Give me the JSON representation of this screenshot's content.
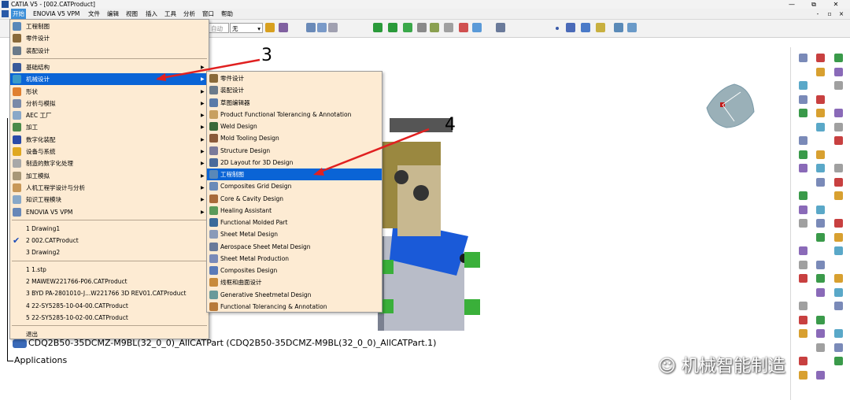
{
  "window": {
    "title": "CATIA V5 - [002.CATProduct]",
    "minimize": "—",
    "restore": "⧉",
    "close": "✕"
  },
  "menubar": {
    "items": [
      "开始",
      "ENOVIA V5 VPM",
      "文件",
      "编辑",
      "视图",
      "插入",
      "工具",
      "分析",
      "窗口",
      "帮助"
    ],
    "right": [
      "-",
      "▫",
      "×"
    ]
  },
  "toolbar": {
    "combo1": "自动",
    "combo2": "无"
  },
  "start_menu": {
    "items": [
      {
        "label": "工程制图",
        "icon": "drawing-icon",
        "color": "#5a88b8",
        "submenu": false
      },
      {
        "label": "零件设计",
        "icon": "part-design-icon",
        "color": "#8a6a3a",
        "submenu": false
      },
      {
        "label": "装配设计",
        "icon": "assembly-design-icon",
        "color": "#6a7a8a",
        "submenu": false
      },
      {
        "label": "基础结构",
        "icon": "infrastructure-icon",
        "color": "#3a5a9a",
        "submenu": true
      },
      {
        "label": "机械设计",
        "icon": "mechanical-design-icon",
        "color": "#3a9ac8",
        "submenu": true
      },
      {
        "label": "形状",
        "icon": "shape-icon",
        "color": "#e08030",
        "submenu": true
      },
      {
        "label": "分析与模拟",
        "icon": "analysis-icon",
        "color": "#7a8aa8",
        "submenu": true
      },
      {
        "label": "AEC 工厂",
        "icon": "aec-plant-icon",
        "color": "#8aa8c8",
        "submenu": true
      },
      {
        "label": "加工",
        "icon": "machining-icon",
        "color": "#4a8a4a",
        "submenu": true
      },
      {
        "label": "数字化装配",
        "icon": "digital-mockup-icon",
        "color": "#2a4aa8",
        "submenu": true
      },
      {
        "label": "设备与系统",
        "icon": "equipment-icon",
        "color": "#e0a820",
        "submenu": true
      },
      {
        "label": "制造的数字化处理",
        "icon": "manufacturing-icon",
        "color": "#a8a8a8",
        "submenu": true
      },
      {
        "label": "加工模拟",
        "icon": "machining-simulation-icon",
        "color": "#a89878",
        "submenu": true
      },
      {
        "label": "人机工程学设计与分析",
        "icon": "ergonomics-icon",
        "color": "#c89858",
        "submenu": true
      },
      {
        "label": "知识工程模块",
        "icon": "knowledgeware-icon",
        "color": "#88a8c8",
        "submenu": true
      },
      {
        "label": "ENOVIA V5 VPM",
        "icon": "enovia-icon",
        "color": "#6888b8",
        "submenu": true
      }
    ],
    "recent_windows": [
      "1 Drawing1",
      "2 002.CATProduct",
      "3 Drawing2"
    ],
    "recent_files": [
      "1 1.stp",
      "2 MAWEW221766-P06.CATProduct",
      "3 BYD PA-2801010-J...W221766 3D REV01.CATProduct",
      "4 22-SY5285-10-04-00.CATProduct",
      "5 22-SY5285-10-02-00.CATProduct"
    ],
    "exit": "退出"
  },
  "submenu": {
    "items": [
      {
        "label": "零件设计",
        "icon": "part-design-icon",
        "color": "#8a6a3a"
      },
      {
        "label": "装配设计",
        "icon": "assembly-design-icon",
        "color": "#6a7a8a"
      },
      {
        "label": "草图编辑器",
        "icon": "sketcher-icon",
        "color": "#5a7aa8"
      },
      {
        "label": "Product Functional Tolerancing & Annotation",
        "icon": "tolerancing-icon",
        "color": "#c8a060"
      },
      {
        "label": "Weld Design",
        "icon": "weld-design-icon",
        "color": "#3a6a3a"
      },
      {
        "label": "Mold Tooling Design",
        "icon": "mold-tooling-icon",
        "color": "#8a5a3a"
      },
      {
        "label": "Structure Design",
        "icon": "structure-design-icon",
        "color": "#7a7a9a"
      },
      {
        "label": "2D Layout for 3D Design",
        "icon": "layout-2d-icon",
        "color": "#4a6a9a"
      },
      {
        "label": "工程制图",
        "icon": "drawing-icon",
        "color": "#5a88b8"
      },
      {
        "label": "Composites Grid Design",
        "icon": "composites-grid-icon",
        "color": "#6a8ab8"
      },
      {
        "label": "Core & Cavity Design",
        "icon": "core-cavity-icon",
        "color": "#a86a3a"
      },
      {
        "label": "Healing Assistant",
        "icon": "healing-icon",
        "color": "#5a9a5a"
      },
      {
        "label": "Functional Molded Part",
        "icon": "molded-part-icon",
        "color": "#3a6a9a"
      },
      {
        "label": "Sheet Metal Design",
        "icon": "sheet-metal-icon",
        "color": "#8a9ab8"
      },
      {
        "label": "Aerospace Sheet Metal  Design",
        "icon": "aerospace-sheet-icon",
        "color": "#6a7a9a"
      },
      {
        "label": "Sheet Metal Production",
        "icon": "sheet-production-icon",
        "color": "#7a8ab8"
      },
      {
        "label": "Composites Design",
        "icon": "composites-icon",
        "color": "#5a7ab8"
      },
      {
        "label": "线框和曲面设计",
        "icon": "wireframe-surface-icon",
        "color": "#c88a3a"
      },
      {
        "label": "Generative Sheetmetal Design",
        "icon": "generative-sheet-icon",
        "color": "#6a9a9a"
      },
      {
        "label": "Functional Tolerancing & Annotation",
        "icon": "functional-tolerancing-icon",
        "color": "#b87a3a"
      }
    ]
  },
  "tree": {
    "part": "CDQ2B50-35DCMZ-M9BL(32_0_0)_AllCATPart (CDQ2B50-35DCMZ-M9BL(32_0_0)_AllCATPart.1)",
    "applications": "Applications"
  },
  "annotations": {
    "step3": "3",
    "step4": "4"
  },
  "watermark": "机械智能制造",
  "colors": {
    "menu_bg": "#fdebd3",
    "highlight": "#0a64d6",
    "annotation_red": "#e02020",
    "part_blue": "#1a5ad8"
  }
}
